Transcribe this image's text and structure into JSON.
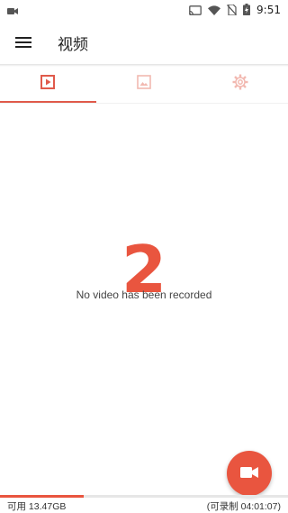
{
  "status_bar": {
    "time": "9:51",
    "icons": [
      "video-camera-icon",
      "cast-icon",
      "wifi-icon",
      "no-sim-icon",
      "battery-charging-icon"
    ]
  },
  "app_bar": {
    "title": "视频",
    "menu_icon": "hamburger-menu-icon"
  },
  "tabs": [
    {
      "icon": "video-play-icon",
      "active": true
    },
    {
      "icon": "image-icon",
      "active": false
    },
    {
      "icon": "settings-gear-icon",
      "active": false
    }
  ],
  "overlay_number": "2",
  "empty_state": {
    "message": "No video has been recorded"
  },
  "fab": {
    "icon": "video-camera-icon"
  },
  "storage": {
    "available": "可用 13.47GB",
    "recordable": "(可录制 04:01:07)",
    "used_fraction": 0.29
  },
  "colors": {
    "accent": "#e9553f",
    "tab_active": "#e05a4b",
    "tab_inactive": "#f2b9b1"
  }
}
